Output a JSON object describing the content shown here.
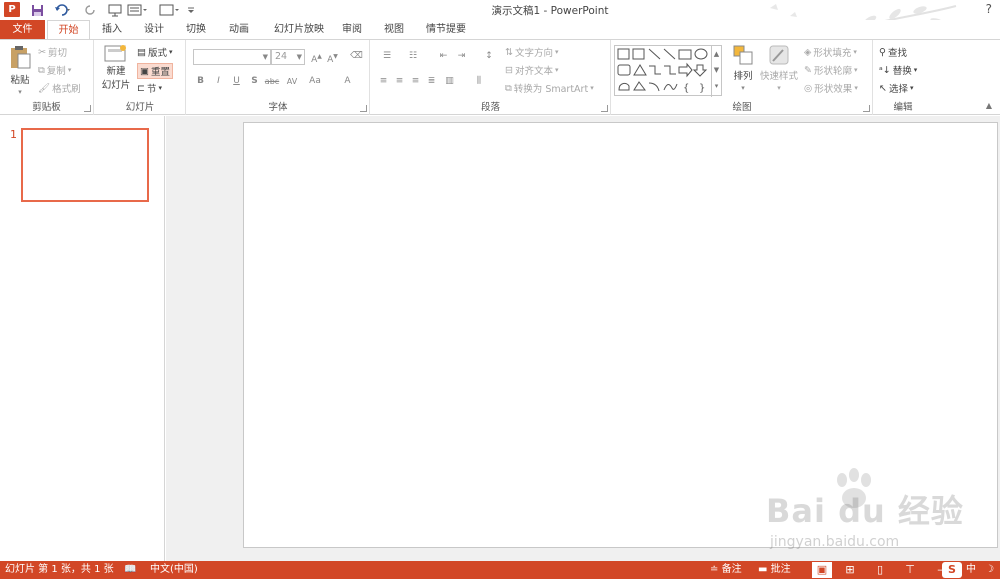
{
  "window": {
    "title": "演示文稿1 - PowerPoint",
    "app_icon": "P",
    "help": "?"
  },
  "tabs": [
    "文件",
    "开始",
    "插入",
    "设计",
    "切换",
    "动画",
    "幻灯片放映",
    "审阅",
    "视图",
    "情节提要"
  ],
  "ribbon": {
    "clipboard": {
      "label": "剪贴板",
      "paste": "粘贴",
      "cut": "剪切",
      "copy": "复制",
      "format_painter": "格式刷"
    },
    "slides": {
      "label": "幻灯片",
      "new_slide_line1": "新建",
      "new_slide_line2": "幻灯片",
      "layout": "版式",
      "reset": "重置",
      "section": "节"
    },
    "font": {
      "label": "字体",
      "font_name": "",
      "font_size": "24",
      "bold": "B",
      "italic": "I",
      "underline": "U",
      "shadow": "S",
      "strike": "abc",
      "spacing": "AV",
      "case": "Aa",
      "color": "A"
    },
    "paragraph": {
      "label": "段落",
      "text_direction": "文字方向",
      "align_text": "对齐文本",
      "smartart": "转换为 SmartArt"
    },
    "drawing": {
      "label": "绘图",
      "arrange": "排列",
      "quick_styles": "快速样式",
      "shape_fill": "形状填充",
      "shape_outline": "形状轮廓",
      "shape_effects": "形状效果"
    },
    "editing": {
      "label": "编辑",
      "find": "查找",
      "replace": "替换",
      "select": "选择"
    }
  },
  "slide_pane": {
    "slide_number": "1"
  },
  "statusbar": {
    "slide_info": "幻灯片 第 1 张，共 1 张",
    "language": "中文(中国)",
    "notes": "备注",
    "comments": "批注",
    "ime": "中"
  },
  "watermark": {
    "logo": "Bai du 经验",
    "site": "jingyan.baidu.com"
  },
  "colors": {
    "accent": "#d24726",
    "thumb_border": "#e8694a"
  }
}
